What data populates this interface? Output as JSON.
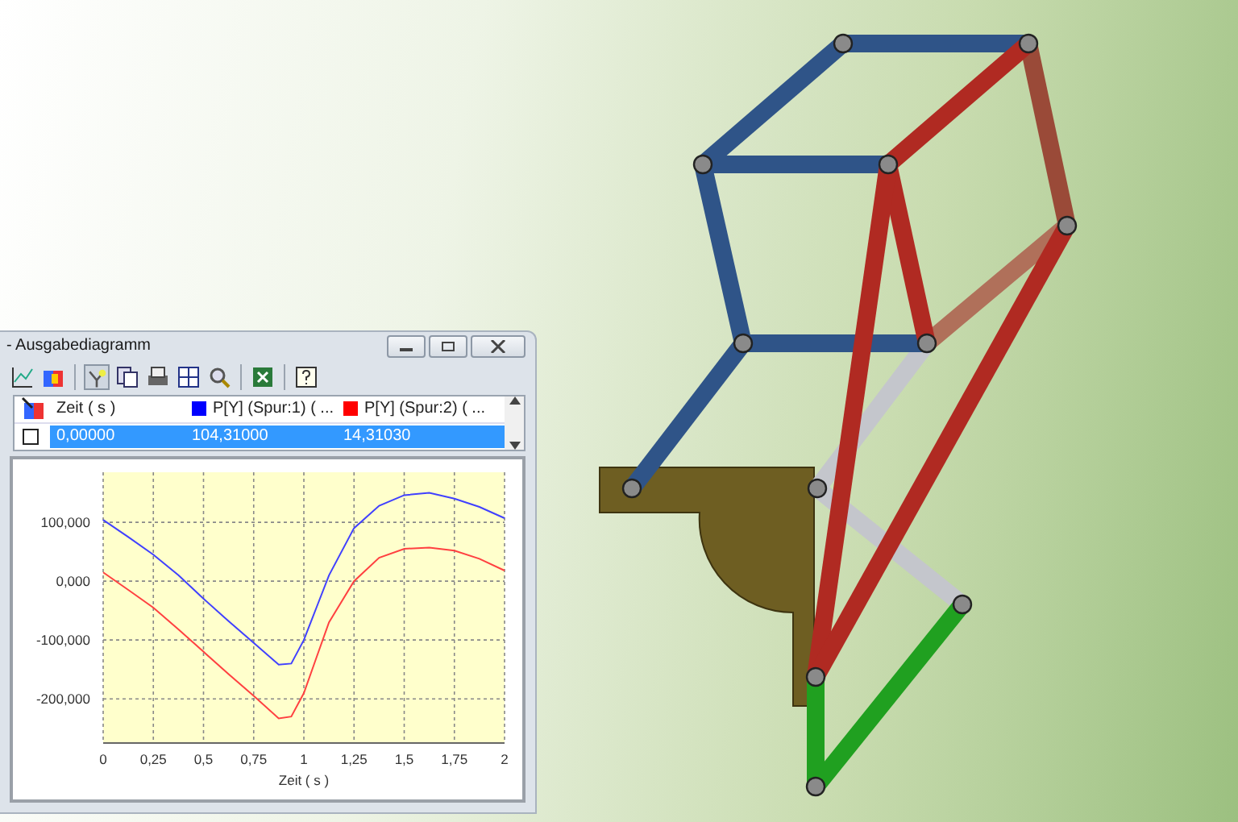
{
  "window": {
    "title": "- Ausgabediagramm"
  },
  "table": {
    "columns": [
      {
        "label": "Zeit ( s )"
      },
      {
        "label": "P[Y] (Spur:1) ( ...",
        "color": "#0000ff"
      },
      {
        "label": "P[Y] (Spur:2) ( ...",
        "color": "#ff0000"
      }
    ],
    "rows": [
      {
        "checked": false,
        "selected": true,
        "cells": [
          "0,00000",
          "104,31000",
          "14,31030"
        ]
      }
    ]
  },
  "chart": {
    "chart_data": {
      "type": "line",
      "xlabel": "Zeit ( s )",
      "x": [
        0,
        0.125,
        0.25,
        0.375,
        0.5,
        0.625,
        0.75,
        0.875,
        0.9375,
        1,
        1.0625,
        1.125,
        1.25,
        1.375,
        1.5,
        1.625,
        1.75,
        1.875,
        2
      ],
      "series": [
        {
          "color": "#4040ff",
          "values": [
            104,
            75,
            45,
            10,
            -30,
            -68,
            -105,
            -142,
            -140,
            -100,
            -45,
            10,
            90,
            128,
            146,
            150,
            140,
            126,
            107
          ]
        },
        {
          "color": "#ff4040",
          "values": [
            15,
            -15,
            -45,
            -82,
            -120,
            -158,
            -195,
            -233,
            -230,
            -190,
            -130,
            -70,
            0,
            40,
            55,
            57,
            52,
            38,
            18
          ]
        }
      ],
      "xlim": [
        0,
        2
      ],
      "ylim": [
        -275,
        185
      ],
      "grid": true,
      "xticks": [
        {
          "value": 0,
          "label": "0"
        },
        {
          "value": 0.25,
          "label": "0,25"
        },
        {
          "value": 0.5,
          "label": "0,5"
        },
        {
          "value": 0.75,
          "label": "0,75"
        },
        {
          "value": 1,
          "label": "1"
        },
        {
          "value": 1.25,
          "label": "1,25"
        },
        {
          "value": 1.5,
          "label": "1,5"
        },
        {
          "value": 1.75,
          "label": "1,75"
        },
        {
          "value": 2,
          "label": "2"
        }
      ],
      "yticks": [
        {
          "value": 100,
          "label": "100,000"
        },
        {
          "value": 0,
          "label": "0,000"
        },
        {
          "value": -100,
          "label": "-100,000"
        },
        {
          "value": -200,
          "label": "-200,000"
        }
      ]
    }
  }
}
